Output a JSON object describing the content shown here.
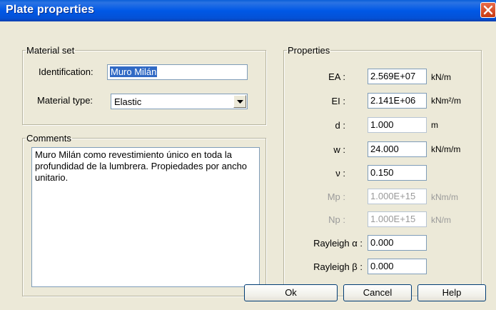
{
  "window": {
    "title": "Plate properties"
  },
  "material_set": {
    "legend": "Material set",
    "identification_label": "Identification:",
    "identification_value": "Muro Milán",
    "material_type_label": "Material type:",
    "material_type_value": "Elastic"
  },
  "comments": {
    "legend": "Comments",
    "text": "Muro Milán como revestimiento único en toda la profundidad de la lumbrera. Propiedades por ancho unitario."
  },
  "properties": {
    "legend": "Properties",
    "rows": [
      {
        "label": "EA :",
        "value": "2.569E+07",
        "unit": "kN/m"
      },
      {
        "label": "EI :",
        "value": "2.141E+06",
        "unit": "kNm²/m"
      },
      {
        "label": "d :",
        "value": "1.000",
        "unit": "m"
      },
      {
        "label": "w :",
        "value": "24.000",
        "unit": "kN/m/m"
      },
      {
        "label": "ν :",
        "value": "0.150",
        "unit": ""
      },
      {
        "label": "Mp :",
        "value": "1.000E+15",
        "unit": "kNm/m"
      },
      {
        "label": "Np :",
        "value": "1.000E+15",
        "unit": "kN/m"
      },
      {
        "label": "Rayleigh α :",
        "value": "0.000",
        "unit": ""
      },
      {
        "label": "Rayleigh β :",
        "value": "0.000",
        "unit": ""
      }
    ]
  },
  "buttons": {
    "ok": "Ok",
    "cancel": "Cancel",
    "help": "Help"
  },
  "icons": {
    "close": "close-icon",
    "dropdown": "chevron-down-icon"
  }
}
